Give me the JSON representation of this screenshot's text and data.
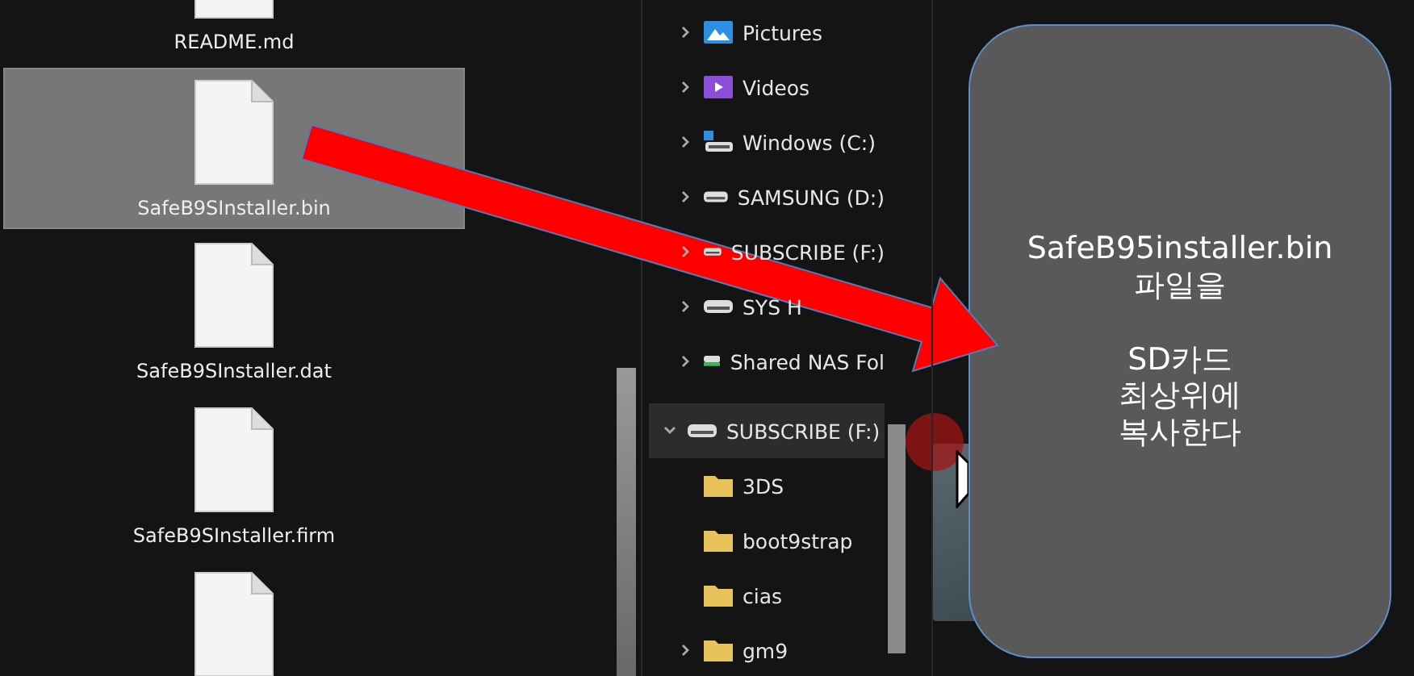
{
  "files": [
    {
      "name": "README.md",
      "selected": false
    },
    {
      "name": "SafeB9SInstaller.bin",
      "selected": true
    },
    {
      "name": "SafeB9SInstaller.dat",
      "selected": false
    },
    {
      "name": "SafeB9SInstaller.firm",
      "selected": false
    },
    {
      "selected": false
    }
  ],
  "nav": {
    "items": [
      {
        "label": "Pictures",
        "kind": "pictures",
        "expanded": false,
        "selected": false
      },
      {
        "label": "Videos",
        "kind": "videos",
        "expanded": false,
        "selected": false
      },
      {
        "label": "Windows (C:)",
        "kind": "system",
        "expanded": false,
        "selected": false
      },
      {
        "label": "SAMSUNG (D:)",
        "kind": "drive",
        "expanded": false,
        "selected": false
      },
      {
        "label": "SUBSCRIBE (F:)",
        "kind": "drive",
        "expanded": false,
        "selected": false
      },
      {
        "label": "SYS H",
        "kind": "drive",
        "expanded": false,
        "selected": false
      },
      {
        "label": "Shared NAS Fol",
        "kind": "network",
        "expanded": false,
        "selected": false
      }
    ],
    "tree": {
      "label": "SUBSCRIBE (F:)",
      "kind": "drive",
      "expanded": true,
      "selected": true,
      "children": [
        {
          "label": "3DS",
          "kind": "folder"
        },
        {
          "label": "boot9strap",
          "kind": "folder"
        },
        {
          "label": "cias",
          "kind": "folder"
        },
        {
          "label": "gm9",
          "kind": "folder",
          "expanded": false
        }
      ]
    }
  },
  "callout": {
    "text": "SafeB95installer.bin\n파일을\n\nSD카드\n최상위에\n복사한다"
  }
}
